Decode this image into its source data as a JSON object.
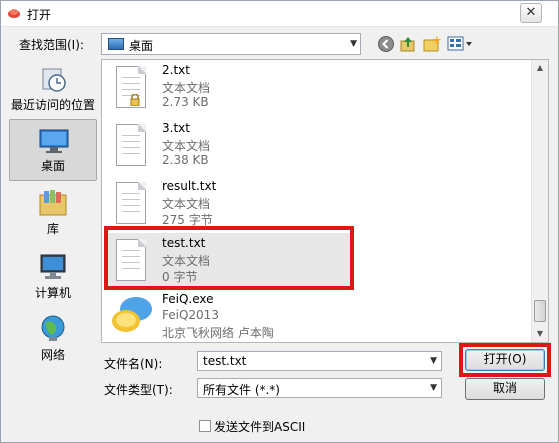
{
  "window": {
    "title": "打开"
  },
  "lookin": {
    "label": "查找范围(I):",
    "value": "桌面"
  },
  "places": [
    {
      "label": "最近访问的位置",
      "icon": "recent-places-icon"
    },
    {
      "label": "桌面",
      "icon": "desktop-icon"
    },
    {
      "label": "库",
      "icon": "libraries-icon"
    },
    {
      "label": "计算机",
      "icon": "computer-icon"
    },
    {
      "label": "网络",
      "icon": "network-icon"
    }
  ],
  "files": [
    {
      "name": "2.txt",
      "type": "文本文档",
      "size": "2.73 KB",
      "locked": true
    },
    {
      "name": "3.txt",
      "type": "文本文档",
      "size": "2.38 KB"
    },
    {
      "name": "result.txt",
      "type": "文本文档",
      "size": "275 字节"
    },
    {
      "name": "test.txt",
      "type": "文本文档",
      "size": "0 字节"
    },
    {
      "name": "FeiQ.exe",
      "type": "FeiQ2013",
      "size": "北京飞秋网络 卢本陶"
    }
  ],
  "filename": {
    "label": "文件名(N):",
    "value": "test.txt"
  },
  "filetype": {
    "label": "文件类型(T):",
    "value": "所有文件 (*.*)"
  },
  "buttons": {
    "open": "打开(O)",
    "cancel": "取消"
  },
  "checkbox": {
    "label": "发送文件到ASCII",
    "checked": false
  },
  "colors": {
    "highlight": "#e01515",
    "selected_bg": "#d8d8d8"
  }
}
